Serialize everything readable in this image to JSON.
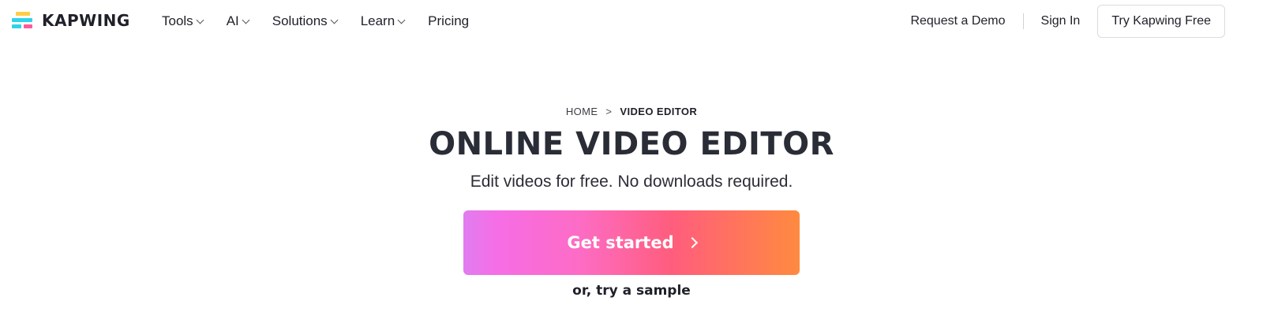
{
  "brand": {
    "name": "KAPWING",
    "icon": "kapwing-logo-icon"
  },
  "nav": {
    "items": [
      {
        "label": "Tools",
        "has_dropdown": true
      },
      {
        "label": "AI",
        "has_dropdown": true
      },
      {
        "label": "Solutions",
        "has_dropdown": true
      },
      {
        "label": "Learn",
        "has_dropdown": true
      },
      {
        "label": "Pricing",
        "has_dropdown": false
      }
    ],
    "request_demo": "Request a Demo",
    "sign_in": "Sign In",
    "try_free": "Try Kapwing Free"
  },
  "breadcrumb": {
    "home": "HOME",
    "separator": ">",
    "current": "VIDEO EDITOR"
  },
  "hero": {
    "title": "ONLINE VIDEO EDITOR",
    "subtitle": "Edit videos for free. No downloads required.",
    "cta": "Get started",
    "secondary": "or, try a sample"
  },
  "colors": {
    "text": "#1f2029",
    "title": "#2a2c36",
    "gradient_start": "#e07df0",
    "gradient_pink": "#fd6cc4",
    "gradient_coral": "#ff5d7d",
    "gradient_end": "#ff8a3f",
    "logo_yellow": "#ffcd45",
    "logo_cyan": "#2fd3ea",
    "logo_pink": "#ff5a9b"
  }
}
